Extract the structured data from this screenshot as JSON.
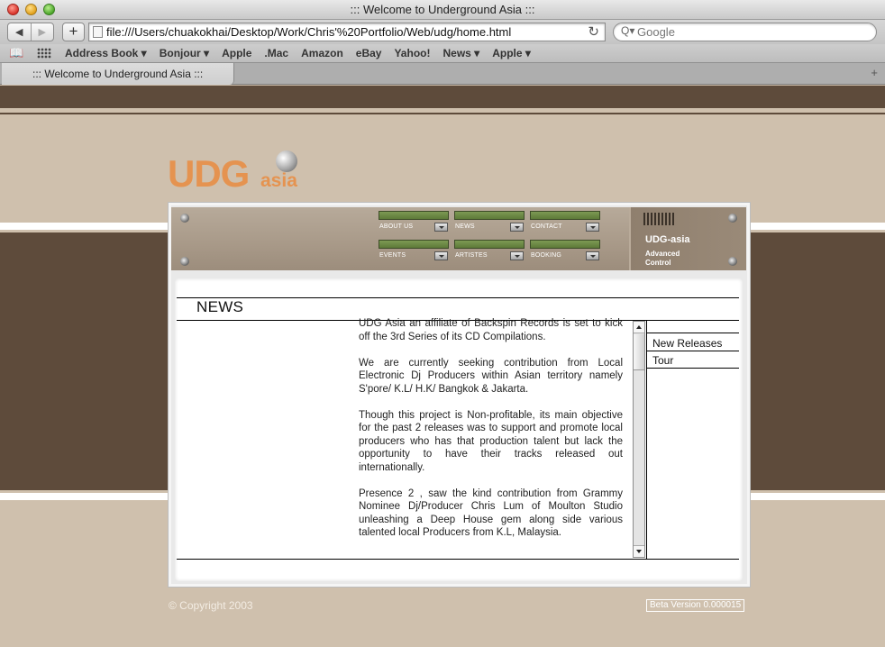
{
  "window": {
    "title": "::: Welcome to Underground Asia :::"
  },
  "toolbar": {
    "back_label": "◀",
    "forward_label": "▶",
    "add_label": "+",
    "url": "file:///Users/chuakokhai/Desktop/Work/Chris'%20Portfolio/Web/udg/home.html",
    "reload_label": "↻",
    "search_placeholder": "Google",
    "search_icon": "Q▾"
  },
  "bookmarks": {
    "book_icon": "📖",
    "items": [
      {
        "label": "Address Book ▾"
      },
      {
        "label": "Bonjour ▾"
      },
      {
        "label": "Apple"
      },
      {
        "label": ".Mac"
      },
      {
        "label": "Amazon"
      },
      {
        "label": "eBay"
      },
      {
        "label": "Yahoo!"
      },
      {
        "label": "News ▾"
      },
      {
        "label": "Apple ▾"
      }
    ]
  },
  "tabs": [
    {
      "label": "::: Welcome to Underground Asia :::"
    }
  ],
  "tab_add": "+",
  "site": {
    "logo_main": "UDG",
    "logo_sub": "asia",
    "console_brand": "UDG-asia",
    "console_sub": "Advanced",
    "console_sub2": "Control",
    "nav": [
      {
        "label": "ABOUT US"
      },
      {
        "label": "NEWS"
      },
      {
        "label": "CONTACT"
      },
      {
        "label": "EVENTS"
      },
      {
        "label": "ARTISTES"
      },
      {
        "label": "BOOKING"
      }
    ],
    "section_title": "NEWS",
    "article": [
      "UDG Asia an affiliate of Backspin Records is set to kick off the 3rd Series of its CD Compilations.",
      "We are currently seeking contribution from Local Electronic Dj Producers within Asian territory namely S'pore/ K.L/ H.K/ Bangkok & Jakarta.",
      "Though this project is Non-profitable, its main objective for the past 2 releases was to support and promote local producers who has that production talent but lack the opportunity to have their tracks released out internationally.",
      "Presence 2 , saw the kind contribution from Grammy Nominee Dj/Producer Chris Lum of Moulton Studio unleashing a Deep House gem along side various talented local Producers from K.L, Malaysia."
    ],
    "side_links": [
      {
        "label": "New Releases"
      },
      {
        "label": "Tour"
      }
    ],
    "copyright": "© Copyright 2003",
    "beta": "Beta Version 0.000015"
  }
}
